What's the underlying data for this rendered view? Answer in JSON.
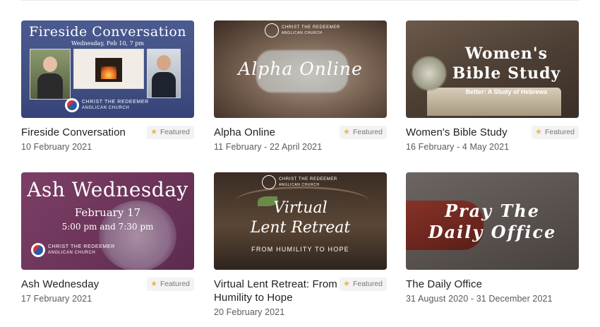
{
  "featured_label": "Featured",
  "org": {
    "line1": "CHRIST THE REDEEMER",
    "line2": "ANGLICAN CHURCH"
  },
  "cards": [
    {
      "title": "Fireside Conversation",
      "date": "10 February 2021",
      "featured": true,
      "thumb": {
        "heading": "Fireside Conversation",
        "sub": "Wednesday, Feb 10, 7 pm"
      }
    },
    {
      "title": "Alpha Online",
      "date": "11 February - 22 April 2021",
      "featured": true,
      "thumb": {
        "heading": "Alpha Online"
      }
    },
    {
      "title": "Women's Bible Study",
      "date": "16 February - 4 May 2021",
      "featured": true,
      "thumb": {
        "heading_line1": "Women's",
        "heading_line2": "Bible Study",
        "sub": "Better: A Study of Hebrews"
      }
    },
    {
      "title": "Ash Wednesday",
      "date": "17 February 2021",
      "featured": true,
      "thumb": {
        "heading": "Ash Wednesday",
        "line2": "February 17",
        "line3": "5:00 pm and 7:30 pm"
      }
    },
    {
      "title": "Virtual Lent Retreat: From Humility to Hope",
      "date": "20 February 2021",
      "featured": true,
      "thumb": {
        "heading_line1": "Virtual",
        "heading_line2": "Lent Retreat",
        "sub": "FROM HUMILITY TO HOPE"
      }
    },
    {
      "title": "The Daily Office",
      "date": "31 August 2020 - 31 December 2021",
      "featured": false,
      "thumb": {
        "heading_line1": "Pray The",
        "heading_line2": "Daily Office"
      }
    }
  ]
}
